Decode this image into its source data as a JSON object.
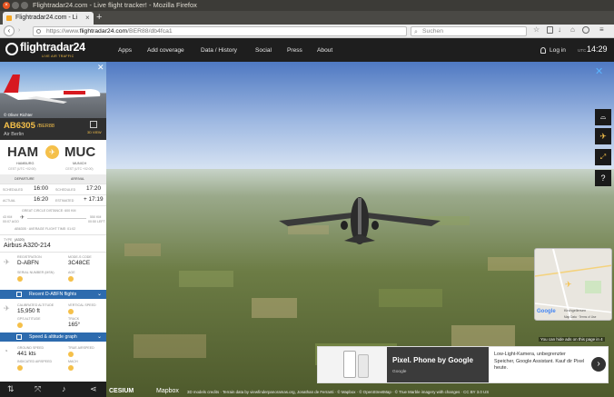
{
  "window": {
    "title": "Flightradar24.com - Live flight tracker! - Mozilla Firefox"
  },
  "tab": {
    "label": "Flightradar24.com - Li",
    "close": "×",
    "new": "+"
  },
  "nav": {
    "url": "https://www.flightradar24.com/BER88/db4fca1",
    "url_prefix": "https://www.",
    "url_domain": "flightradar24.com",
    "url_rest": "/BER88/db4fca1",
    "search_placeholder": "Suchen"
  },
  "site": {
    "logo": "flightradar24",
    "tagline": "LIVE AIR TRAFFIC",
    "menu": [
      "Apps",
      "Add coverage",
      "Data / History",
      "Social",
      "Press",
      "About"
    ],
    "login": "Log in",
    "tz": "UTC",
    "time": "14:29"
  },
  "flight": {
    "photo_credit": "© Oliver Richter",
    "callsign": "AB6305",
    "reg_suffix": "/BER88",
    "airline": "Air Berlin",
    "view3d_label": "3D VIEW",
    "from_code": "HAM",
    "from_city": "HAMBURG",
    "from_tz": "CEST (UTC +02:00)",
    "to_code": "MUC",
    "to_city": "MUNICH",
    "to_tz": "CEST (UTC +02:00)",
    "departure_hdr": "DEPARTURE",
    "arrival_hdr": "ARRIVAL",
    "sched_lbl": "SCHEDULED",
    "sched_dep": "16:00",
    "sched_arr": "17:20",
    "actual_lbl": "ACTUAL",
    "actual_dep": "16:20",
    "est_lbl": "ESTIMATED",
    "est_arr": "+ 17:19",
    "gc_distance": "GREAT CIRCLE DISTANCE: 600 KM",
    "dist_left": "43 KM",
    "dist_left2": "00:07 AGO",
    "dist_right": "550 KM",
    "dist_right2": "00:50 LEFT",
    "avg_time": "AB6305 · AVERAGE FLIGHT TIME: 01:02",
    "type_lbl": "TYPE",
    "type_code": "(A320)",
    "aircraft": "Airbus A320-214",
    "reg_lbl": "REGISTRATION",
    "reg": "D-ABFN",
    "modes_lbl": "MODE-S CODE",
    "modes": "3C48CE",
    "serial_lbl": "SERIAL NUMBER (MSN)",
    "age_lbl": "AGE",
    "recent": "Recent D-ABFN flights",
    "calt_lbl": "CALIBRATED ALTITUDE",
    "calt": "15,950 ft",
    "vspeed_lbl": "VERTICAL SPEED",
    "gps_lbl": "GPS ALTITUDE",
    "track_lbl": "TRACK",
    "track": "165°",
    "speed_graph": "Speed & altitude graph",
    "gspeed_lbl": "GROUND SPEED",
    "gspeed": "441 kts",
    "tas_lbl": "TRUE AIRSPEED",
    "ias_lbl": "INDICATED AIRSPEED",
    "mach_lbl": "MACH"
  },
  "view3d": {
    "credits": "3D models credits · Terrain data by viewfinderpanoramas.org, Jonathan de Ferranti · © Mapbox · © OpenStreetMap · © True Marble imagery with changes · CC BY 3.0 US",
    "cesium": "CESIUM",
    "mapbox": "Mapbox",
    "minimap_google": "Google",
    "minimap_place": "Kirchgellersen",
    "minimap_data": "Map Data · Terms of Use",
    "hide_ads": "You can hide ads on this page in 4"
  },
  "ad": {
    "headline": "Pixel. Phone by Google",
    "brand": "Google",
    "text": "Low-Light-Kamera, unbegrenzter Speicher, Google Assistant. Kauf dir Pixel heute."
  }
}
